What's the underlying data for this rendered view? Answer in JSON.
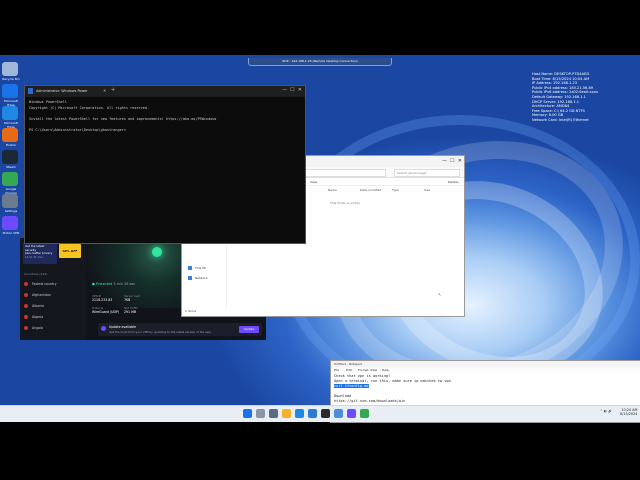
{
  "remote_bar": {
    "title": "RDP - 192.168.1.23 (Remote Desktop Connection)"
  },
  "desktop_icons": [
    {
      "label": "Recycle Bin",
      "color": "#9fb8d8"
    },
    {
      "label": "Microsoft Edge",
      "color": "#1a73e8"
    },
    {
      "label": "Microsoft Edge",
      "color": "#1e88e5"
    },
    {
      "label": "Firefox",
      "color": "#e66a18"
    },
    {
      "label": "Steam",
      "color": "#1b2838"
    },
    {
      "label": "Google Chrome",
      "color": "#34a853"
    },
    {
      "label": "Settings",
      "color": "#6b7a8f"
    },
    {
      "label": "Proton VPN",
      "color": "#6d4aff"
    }
  ],
  "bginfo": {
    "lines": [
      "Host Name: DESKTOP-P7D4AED",
      "Boot Time: 8/15/2024 10:04 AM",
      "IP Address: 192.168.1.23",
      "Public IPv4 address: 185.21.56.89",
      "Public IPv6 address: 2a02:6ea0:xxxx",
      "Default Gateway: 192.168.1.1",
      "DHCP Server: 192.168.1.1",
      "Architecture: AMD64",
      "Free Space: C:\\ 64.2 GB NTFS",
      "Memory: 8.00 GB",
      "Network Card: Intel(R) Ethernet"
    ]
  },
  "powershell": {
    "title": "Administrator: Windows Power",
    "lines": [
      "Windows PowerShell",
      "Copyright (C) Microsoft Corporation. All rights reserved.",
      "",
      "Install the latest PowerShell for new features and improvements! https://aka.ms/PSWindows",
      "",
      "PS C:\\Users\\Administrator\\Desktop\\ghostranger>"
    ]
  },
  "explorer": {
    "address": "ghostranger",
    "search_placeholder": "Search ghostranger",
    "details_label": "Details",
    "view_label": "View",
    "columns": [
      "Name",
      "Date modified",
      "Type",
      "Size"
    ],
    "empty_text": "This folder is empty.",
    "nav_items": [
      {
        "label": "Pictures",
        "color": "#3b82d6"
      },
      {
        "label": "Music",
        "color": "#e84c3d"
      },
      {
        "label": "Videos",
        "color": "#7b4ad8"
      },
      {
        "label": "This PC",
        "color": "#3b82d6"
      },
      {
        "label": "Network",
        "color": "#3b82d6"
      }
    ],
    "status": "0 items"
  },
  "vpn": {
    "promo_line1": "Get the latest security",
    "promo_line2": "plus, better privacy",
    "promo_line3": "11 to 31 min",
    "promo_button": "60% OFF",
    "countries_header": "Countries (120)",
    "countries": [
      "Fastest country",
      "Afghanistan",
      "Albania",
      "Algeria",
      "Angola"
    ],
    "status": "Protected",
    "status_sub": "3 min 28 sec",
    "stats": [
      {
        "label": "VPN IP",
        "value": "2118.233.83"
      },
      {
        "label": "Server load",
        "value": "7KB"
      },
      {
        "label": "Protocol",
        "value": "WireGuard (UDP)"
      },
      {
        "label": "Net traffic",
        "value": "291 MB"
      }
    ],
    "update_title": "Update available",
    "update_text": "Get the most from your VPN by updating to the latest version of the app.",
    "update_button": "Update",
    "accent": "#6d4aff"
  },
  "notepad": {
    "title": "Untitled - Notepad",
    "menu": [
      "File",
      "Edit",
      "Format",
      "View",
      "Help"
    ],
    "lines": [
      "Check that vpn is working!",
      "Open a terminal, run this, make sure ip matches to vpn",
      "curl ifconfig.me",
      "",
      "Download",
      "https://gif-scm.com/downloads/win"
    ],
    "highlight_index": 2
  },
  "taskbar": {
    "time": "10:24 AM",
    "date": "8/15/2024",
    "apps": [
      {
        "name": "start-icon",
        "color": "#1a73e8"
      },
      {
        "name": "search-icon",
        "color": "#8a96a8"
      },
      {
        "name": "task-view-icon",
        "color": "#5a6b85"
      },
      {
        "name": "explorer-icon",
        "color": "#f3b22a"
      },
      {
        "name": "edge-icon",
        "color": "#1e88e5"
      },
      {
        "name": "store-icon",
        "color": "#2b7cd3"
      },
      {
        "name": "terminal-icon",
        "color": "#2b2b2b"
      },
      {
        "name": "notepad-icon",
        "color": "#4c8fd6"
      },
      {
        "name": "vpn-icon",
        "color": "#6d4aff"
      },
      {
        "name": "chrome-icon",
        "color": "#34a853"
      }
    ]
  }
}
